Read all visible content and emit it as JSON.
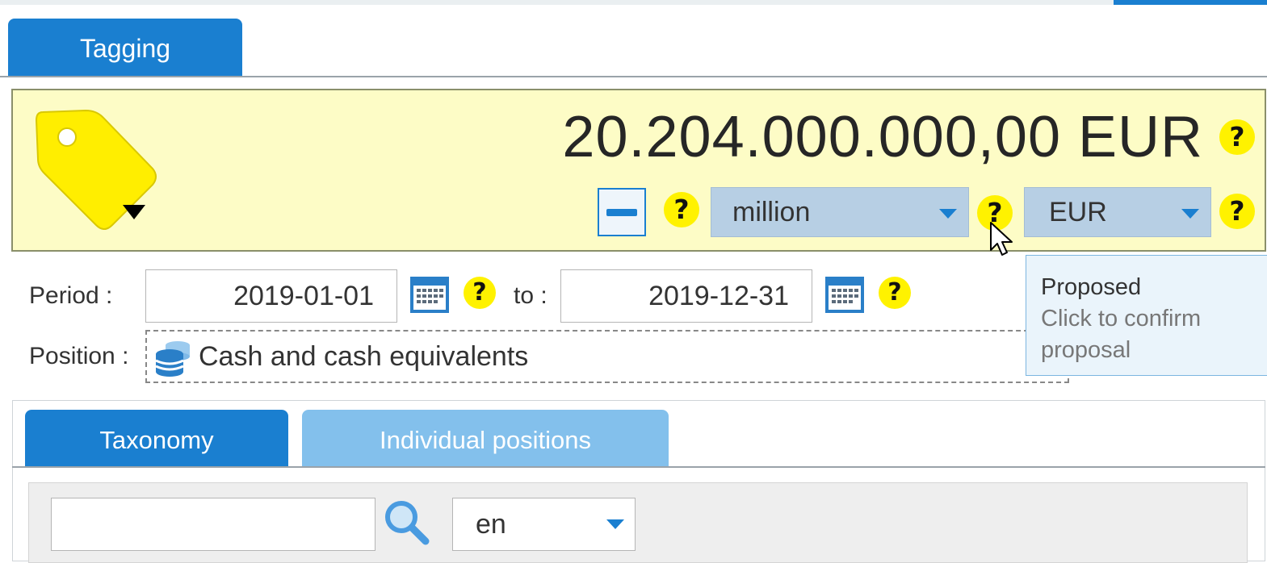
{
  "tabs": {
    "main": "Tagging"
  },
  "amount": {
    "value": "20.204.000.000,00 EUR",
    "help": "?",
    "scale_select": "million",
    "currency_select": "EUR"
  },
  "period": {
    "label": "Period :",
    "from": "2019-01-01",
    "to_label": "to :",
    "to": "2019-12-31"
  },
  "position": {
    "label": "Position :",
    "value": "Cash and cash equivalents"
  },
  "tooltip": {
    "title": "Proposed",
    "line1": "Click to confirm",
    "line2": "proposal"
  },
  "sub_tabs": [
    "Taxonomy",
    "Individual positions"
  ],
  "search": {
    "value": "",
    "language": "en"
  },
  "colors": {
    "accent": "#1a7fd0",
    "accent_light": "#83c0ec",
    "panel_bg": "#fdfcc6",
    "help_yellow": "#fff200",
    "tag_yellow": "#ffee00"
  },
  "icons": [
    "tag-icon",
    "minus-icon",
    "help-icon",
    "calendar-icon",
    "database-icon",
    "magnifier-icon",
    "cursor-icon"
  ]
}
